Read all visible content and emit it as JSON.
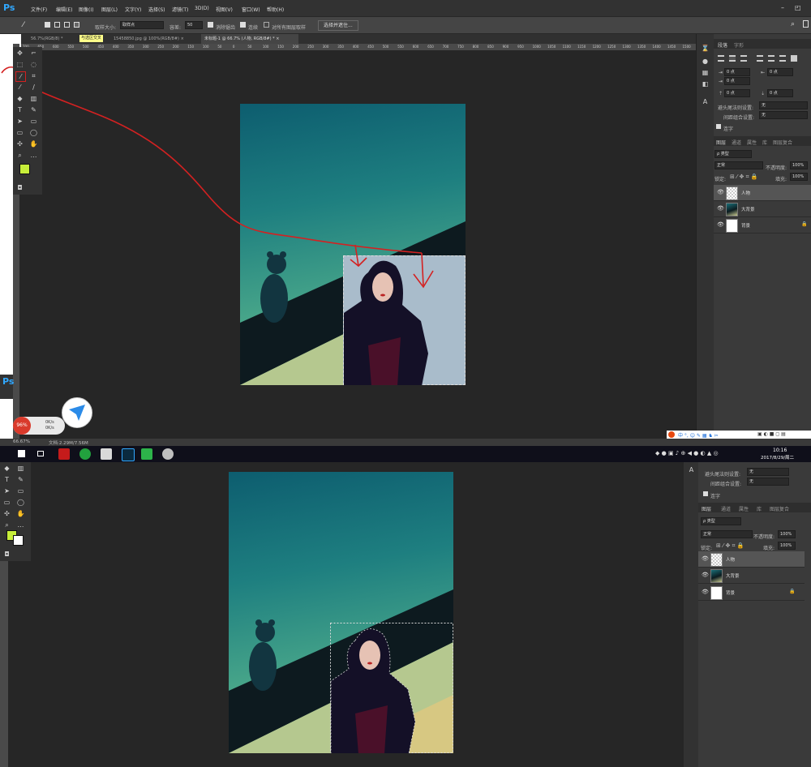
{
  "app": {
    "logo": "Ps"
  },
  "menu": [
    "文件(F)",
    "编辑(E)",
    "图像(I)",
    "图层(L)",
    "文字(Y)",
    "选择(S)",
    "滤镜(T)",
    "3D(D)",
    "视图(V)",
    "窗口(W)",
    "帮助(H)"
  ],
  "window_controls": {
    "minimize": "–",
    "restore": "◰"
  },
  "options": {
    "sample_size_label": "取样大小:",
    "sample_size_value": "取样点",
    "tolerance_label": "容差:",
    "tolerance_value": "50",
    "antialias_label": "消除锯齿",
    "contiguous_label": "连续",
    "all_layers_label": "对所有图层取样",
    "select_mask_button": "选择并遮住..."
  },
  "tabs": [
    {
      "label": "56.7%(RGB/8) *",
      "active": false
    },
    {
      "label": "与选区交叉",
      "highlight": true
    },
    {
      "label": "15458850.jpg @ 100%(RGB/8#) ×",
      "active": false
    },
    {
      "label": "未标题-1 @ 66.7% (人物, RGB/8#) * ×",
      "active": true
    }
  ],
  "ruler_ticks": [
    "700",
    "650",
    "600",
    "550",
    "500",
    "450",
    "400",
    "350",
    "300",
    "250",
    "200",
    "150",
    "100",
    "50",
    "0",
    "50",
    "100",
    "150",
    "200",
    "250",
    "300",
    "350",
    "400",
    "450",
    "500",
    "550",
    "600",
    "650",
    "700",
    "750",
    "800",
    "850",
    "900",
    "950",
    "1000",
    "1050",
    "1100",
    "1150",
    "1200",
    "1250",
    "1300",
    "1350",
    "1400",
    "1450",
    "1500"
  ],
  "right_tabs": {
    "paragraph": "段落",
    "char": "字形"
  },
  "paragraph": {
    "indent_left": "0 点",
    "indent_right": "0 点",
    "indent_first": "0 点",
    "space_before": "0 点",
    "space_after": "0 点",
    "kinsoku_label": "避头尾法则设置:",
    "kinsoku_value": "无",
    "spacing_label": "间距组合设置:",
    "spacing_value": "无",
    "hyphen_label": "连字"
  },
  "layers_tabs": [
    "图层",
    "通道",
    "属性",
    "库",
    "图层复合"
  ],
  "layers_filter": "ρ 类型",
  "blend_mode": "正常",
  "opacity_label": "不透明度:",
  "opacity_value": "100%",
  "lock_label": "锁定:",
  "fill_label": "填充:",
  "fill_value": "100%",
  "layers": [
    {
      "name": "人物",
      "selected": true
    },
    {
      "name": "大背景",
      "selected": false
    },
    {
      "name": "背景",
      "selected": false,
      "locked": true
    }
  ],
  "status": {
    "zoom": "66.67%",
    "doc": "文档:2.29M/7.56M"
  },
  "floating_widget": {
    "percent": "96%",
    "up": "0K/s",
    "down": "0K/s"
  },
  "taskbar": {
    "time": "10:16",
    "date": "2017/8/29/周二"
  },
  "second": {
    "kinsoku_label": "避头尾法则设置:",
    "kinsoku_value": "无",
    "spacing_label": "间距组合设置:",
    "spacing_value": "无",
    "hyphen_label": "连字"
  },
  "colors": {
    "fg": "#c7ee3a",
    "bg": "#ffffff",
    "annotation": "#d42121"
  }
}
